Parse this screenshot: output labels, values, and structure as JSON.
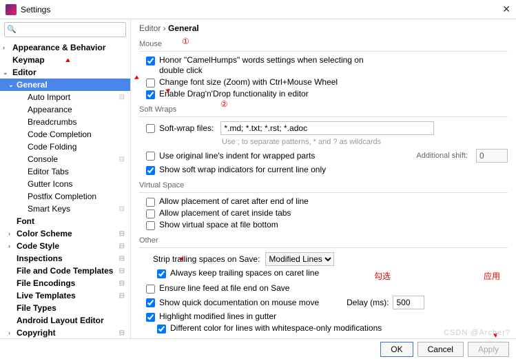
{
  "window": {
    "title": "Settings"
  },
  "search": {
    "placeholder": ""
  },
  "breadcrumb": {
    "a": "Editor",
    "sep": "›",
    "b": "General"
  },
  "tree": {
    "items": [
      {
        "label": "Appearance & Behavior",
        "level": 0,
        "chev": "›",
        "sel": false
      },
      {
        "label": "Keymap",
        "level": 0,
        "chev": "",
        "sel": false
      },
      {
        "label": "Editor",
        "level": 0,
        "chev": "⌄",
        "sel": false
      },
      {
        "label": "General",
        "level": 1,
        "chev": "⌄",
        "sel": true
      },
      {
        "label": "Auto Import",
        "level": 2,
        "ind": true
      },
      {
        "label": "Appearance",
        "level": 2
      },
      {
        "label": "Breadcrumbs",
        "level": 2
      },
      {
        "label": "Code Completion",
        "level": 2
      },
      {
        "label": "Code Folding",
        "level": 2
      },
      {
        "label": "Console",
        "level": 2,
        "ind": true
      },
      {
        "label": "Editor Tabs",
        "level": 2
      },
      {
        "label": "Gutter Icons",
        "level": 2
      },
      {
        "label": "Postfix Completion",
        "level": 2
      },
      {
        "label": "Smart Keys",
        "level": 2,
        "ind": true
      },
      {
        "label": "Font",
        "level": 1,
        "chev": ""
      },
      {
        "label": "Color Scheme",
        "level": 1,
        "chev": "›",
        "ind": true
      },
      {
        "label": "Code Style",
        "level": 1,
        "chev": "›",
        "ind": true
      },
      {
        "label": "Inspections",
        "level": 1,
        "chev": "",
        "ind": true
      },
      {
        "label": "File and Code Templates",
        "level": 1,
        "chev": "",
        "ind": true
      },
      {
        "label": "File Encodings",
        "level": 1,
        "chev": "",
        "ind": true
      },
      {
        "label": "Live Templates",
        "level": 1,
        "chev": "",
        "ind": true
      },
      {
        "label": "File Types",
        "level": 1,
        "chev": ""
      },
      {
        "label": "Android Layout Editor",
        "level": 1,
        "chev": ""
      },
      {
        "label": "Copyright",
        "level": 1,
        "chev": "›",
        "ind": true
      }
    ]
  },
  "groups": {
    "mouse": "Mouse",
    "softwraps": "Soft Wraps",
    "virtual": "Virtual Space",
    "other": "Other"
  },
  "mouse": {
    "honor": "Honor \"CamelHumps\" words settings when selecting on double click",
    "zoom": "Change font size (Zoom) with Ctrl+Mouse Wheel",
    "dnd": "Enable Drag'n'Drop functionality in editor"
  },
  "soft": {
    "check": "Soft-wrap files:",
    "value": "*.md; *.txt; *.rst; *.adoc",
    "hint": "Use ; to separate patterns, * and ? as wildcards",
    "orig": "Use original line's indent for wrapped parts",
    "addshift": "Additional shift:",
    "addshift_val": "0",
    "indic": "Show soft wrap indicators for current line only"
  },
  "virtual": {
    "after": "Allow placement of caret after end of line",
    "tabs": "Allow placement of caret inside tabs",
    "bottom": "Show virtual space at file bottom"
  },
  "other": {
    "strip_lbl": "Strip trailing spaces on Save:",
    "strip_val": "Modified Lines",
    "keepcaret": "Always keep trailing spaces on caret line",
    "lf": "Ensure line feed at file end on Save",
    "quickdoc": "Show quick documentation on mouse move",
    "delay_lbl": "Delay (ms):",
    "delay_val": "500",
    "highlight": "Highlight modified lines in gutter",
    "diffcolor": "Different color for lines with whitespace-only modifications"
  },
  "buttons": {
    "ok": "OK",
    "cancel": "Cancel",
    "apply": "Apply"
  },
  "anno": {
    "n1": "①",
    "n2": "②",
    "check": "勾选",
    "apply": "应用"
  },
  "watermark": "CSDN @Archer?"
}
